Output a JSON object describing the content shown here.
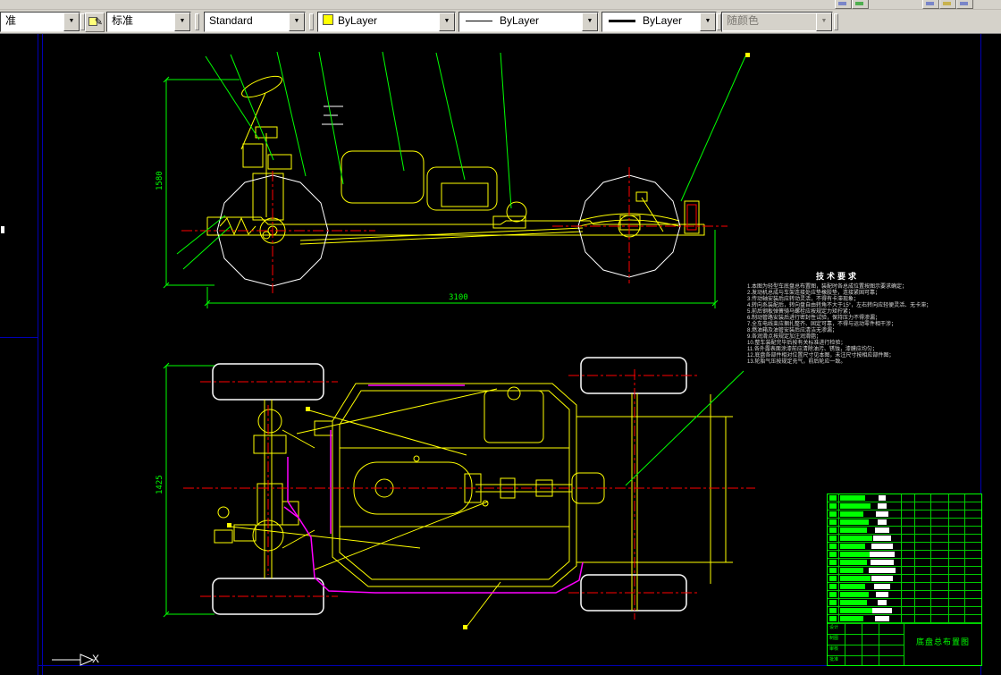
{
  "toolbar": {
    "layer_value": "准",
    "textstyle_value": "标准",
    "dimstyle_value": "Standard",
    "color_value": "ByLayer",
    "linetype_value": "ByLayer",
    "lineweight_value": "ByLayer",
    "plotstyle_value": "随颜色"
  },
  "drawing": {
    "notes_title": "技术要求",
    "notes": "1.本图为轻型车底盘总布置图，装配时各总成位置按图示要求确定；\n2.发动机总成与车架连接处应垫橡胶垫，连接紧固可靠；\n3.传动轴安装后应转动灵活，不得有卡滞现象；\n4.转向系装配后，转向盘自由转角不大于15°，左右转向应轻便灵活、无卡滞；\n5.前后钢板弹簧骑马螺栓应按规定力矩拧紧；\n6.制动管路安装后进行密封性试验，保持压力不得渗漏；\n7.全车电线束应捆扎整齐、固定可靠，不得与运动零件相干涉；\n8.燃油箱及油管安装后应清洁无渗漏；\n9.各润滑点按规定加注润滑脂；\n10.整车装配完毕后按有关标准进行检验；\n11.各外露表面涂漆前应清除油污、锈蚀，漆膜应均匀；\n12.底盘各部件相对位置尺寸见本图，未注尺寸按相应部件图；\n13.轮胎气压按规定充气，前后轮应一致。",
    "dims": {
      "overall_length": "3100",
      "overall_height": "1580",
      "track_width": "1425"
    },
    "ucs_x": "X"
  },
  "titleblock": {
    "title": "底盘总布置图",
    "sig_labels": [
      "设计",
      "制图",
      "审核",
      "批准"
    ],
    "green_widths": [
      28,
      34,
      26,
      32,
      30,
      36,
      28,
      34,
      30,
      26,
      34,
      28,
      32,
      30,
      36,
      26
    ],
    "white_widths": [
      8,
      10,
      14,
      10,
      16,
      20,
      24,
      28,
      26,
      30,
      24,
      18,
      14,
      10,
      22,
      16
    ]
  },
  "colors": {
    "line_yellow": "#ffff00",
    "center_red": "#ff0000",
    "dim_green": "#00ff00",
    "cable_magenta": "#ff00ff",
    "sheet_blue": "#0000b4"
  }
}
